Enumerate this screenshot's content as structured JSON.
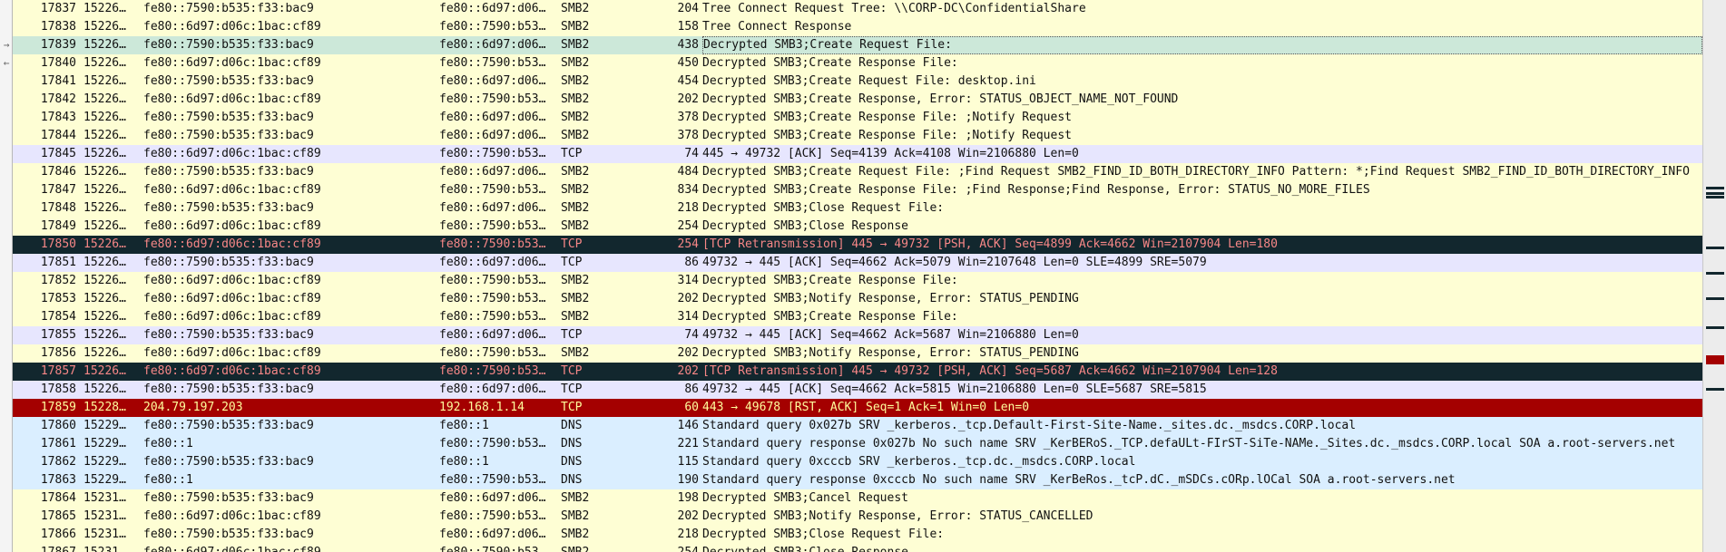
{
  "packet_list": {
    "rows": [
      {
        "no": "17837",
        "time": "15226…",
        "src": "fe80::7590:b535:f33:bac9",
        "dst": "fe80::6d97:d06…",
        "proto": "SMB2",
        "len": "204",
        "info": "Tree Connect Request Tree: \\\\CORP-DC\\ConfidentialShare",
        "style": "smb",
        "mark": ""
      },
      {
        "no": "17838",
        "time": "15226…",
        "src": "fe80::6d97:d06c:1bac:cf89",
        "dst": "fe80::7590:b53…",
        "proto": "SMB2",
        "len": "158",
        "info": "Tree Connect Response",
        "style": "smb",
        "mark": ""
      },
      {
        "no": "17839",
        "time": "15226…",
        "src": "fe80::7590:b535:f33:bac9",
        "dst": "fe80::6d97:d06…",
        "proto": "SMB2",
        "len": "438",
        "info": "Decrypted SMB3;Create Request File:",
        "style": "selected",
        "mark": "→"
      },
      {
        "no": "17840",
        "time": "15226…",
        "src": "fe80::6d97:d06c:1bac:cf89",
        "dst": "fe80::7590:b53…",
        "proto": "SMB2",
        "len": "450",
        "info": "Decrypted SMB3;Create Response File:",
        "style": "smb",
        "mark": "←"
      },
      {
        "no": "17841",
        "time": "15226…",
        "src": "fe80::7590:b535:f33:bac9",
        "dst": "fe80::6d97:d06…",
        "proto": "SMB2",
        "len": "454",
        "info": "Decrypted SMB3;Create Request File: desktop.ini",
        "style": "smb",
        "mark": ""
      },
      {
        "no": "17842",
        "time": "15226…",
        "src": "fe80::6d97:d06c:1bac:cf89",
        "dst": "fe80::7590:b53…",
        "proto": "SMB2",
        "len": "202",
        "info": "Decrypted SMB3;Create Response, Error: STATUS_OBJECT_NAME_NOT_FOUND",
        "style": "smb",
        "mark": ""
      },
      {
        "no": "17843",
        "time": "15226…",
        "src": "fe80::7590:b535:f33:bac9",
        "dst": "fe80::6d97:d06…",
        "proto": "SMB2",
        "len": "378",
        "info": "Decrypted SMB3;Create Response File: ;Notify Request",
        "style": "smb",
        "mark": ""
      },
      {
        "no": "17844",
        "time": "15226…",
        "src": "fe80::7590:b535:f33:bac9",
        "dst": "fe80::6d97:d06…",
        "proto": "SMB2",
        "len": "378",
        "info": "Decrypted SMB3;Create Response File: ;Notify Request",
        "style": "smb",
        "mark": ""
      },
      {
        "no": "17845",
        "time": "15226…",
        "src": "fe80::6d97:d06c:1bac:cf89",
        "dst": "fe80::7590:b53…",
        "proto": "TCP",
        "len": "74",
        "info": "445 → 49732 [ACK] Seq=4139 Ack=4108 Win=2106880 Len=0",
        "style": "tcp",
        "mark": ""
      },
      {
        "no": "17846",
        "time": "15226…",
        "src": "fe80::7590:b535:f33:bac9",
        "dst": "fe80::6d97:d06…",
        "proto": "SMB2",
        "len": "484",
        "info": "Decrypted SMB3;Create Request File: ;Find Request SMB2_FIND_ID_BOTH_DIRECTORY_INFO Pattern: *;Find Request SMB2_FIND_ID_BOTH_DIRECTORY_INFO",
        "style": "smb",
        "mark": ""
      },
      {
        "no": "17847",
        "time": "15226…",
        "src": "fe80::6d97:d06c:1bac:cf89",
        "dst": "fe80::7590:b53…",
        "proto": "SMB2",
        "len": "834",
        "info": "Decrypted SMB3;Create Response File: ;Find Response;Find Response, Error: STATUS_NO_MORE_FILES",
        "style": "smb",
        "mark": ""
      },
      {
        "no": "17848",
        "time": "15226…",
        "src": "fe80::7590:b535:f33:bac9",
        "dst": "fe80::6d97:d06…",
        "proto": "SMB2",
        "len": "218",
        "info": "Decrypted SMB3;Close Request File:",
        "style": "smb",
        "mark": ""
      },
      {
        "no": "17849",
        "time": "15226…",
        "src": "fe80::6d97:d06c:1bac:cf89",
        "dst": "fe80::7590:b53…",
        "proto": "SMB2",
        "len": "254",
        "info": "Decrypted SMB3;Close Response",
        "style": "smb",
        "mark": ""
      },
      {
        "no": "17850",
        "time": "15226…",
        "src": "fe80::6d97:d06c:1bac:cf89",
        "dst": "fe80::7590:b53…",
        "proto": "TCP",
        "len": "254",
        "info": "[TCP Retransmission] 445 → 49732 [PSH, ACK] Seq=4899 Ack=4662 Win=2107904 Len=180",
        "style": "bad",
        "mark": ""
      },
      {
        "no": "17851",
        "time": "15226…",
        "src": "fe80::7590:b535:f33:bac9",
        "dst": "fe80::6d97:d06…",
        "proto": "TCP",
        "len": "86",
        "info": "49732 → 445 [ACK] Seq=4662 Ack=5079 Win=2107648 Len=0 SLE=4899 SRE=5079",
        "style": "tcp",
        "mark": ""
      },
      {
        "no": "17852",
        "time": "15226…",
        "src": "fe80::6d97:d06c:1bac:cf89",
        "dst": "fe80::7590:b53…",
        "proto": "SMB2",
        "len": "314",
        "info": "Decrypted SMB3;Create Response File:",
        "style": "smb",
        "mark": ""
      },
      {
        "no": "17853",
        "time": "15226…",
        "src": "fe80::6d97:d06c:1bac:cf89",
        "dst": "fe80::7590:b53…",
        "proto": "SMB2",
        "len": "202",
        "info": "Decrypted SMB3;Notify Response, Error: STATUS_PENDING",
        "style": "smb",
        "mark": ""
      },
      {
        "no": "17854",
        "time": "15226…",
        "src": "fe80::6d97:d06c:1bac:cf89",
        "dst": "fe80::7590:b53…",
        "proto": "SMB2",
        "len": "314",
        "info": "Decrypted SMB3;Create Response File:",
        "style": "smb",
        "mark": ""
      },
      {
        "no": "17855",
        "time": "15226…",
        "src": "fe80::7590:b535:f33:bac9",
        "dst": "fe80::6d97:d06…",
        "proto": "TCP",
        "len": "74",
        "info": "49732 → 445 [ACK] Seq=4662 Ack=5687 Win=2106880 Len=0",
        "style": "tcp",
        "mark": ""
      },
      {
        "no": "17856",
        "time": "15226…",
        "src": "fe80::6d97:d06c:1bac:cf89",
        "dst": "fe80::7590:b53…",
        "proto": "SMB2",
        "len": "202",
        "info": "Decrypted SMB3;Notify Response, Error: STATUS_PENDING",
        "style": "smb",
        "mark": ""
      },
      {
        "no": "17857",
        "time": "15226…",
        "src": "fe80::6d97:d06c:1bac:cf89",
        "dst": "fe80::7590:b53…",
        "proto": "TCP",
        "len": "202",
        "info": "[TCP Retransmission] 445 → 49732 [PSH, ACK] Seq=5687 Ack=4662 Win=2107904 Len=128",
        "style": "bad",
        "mark": ""
      },
      {
        "no": "17858",
        "time": "15226…",
        "src": "fe80::7590:b535:f33:bac9",
        "dst": "fe80::6d97:d06…",
        "proto": "TCP",
        "len": "86",
        "info": "49732 → 445 [ACK] Seq=4662 Ack=5815 Win=2106880 Len=0 SLE=5687 SRE=5815",
        "style": "tcp",
        "mark": ""
      },
      {
        "no": "17859",
        "time": "15228…",
        "src": "204.79.197.203",
        "dst": "192.168.1.14",
        "proto": "TCP",
        "len": "60",
        "info": "443 → 49678 [RST, ACK] Seq=1 Ack=1 Win=0 Len=0",
        "style": "rst",
        "mark": ""
      },
      {
        "no": "17860",
        "time": "15229…",
        "src": "fe80::7590:b535:f33:bac9",
        "dst": "fe80::1",
        "proto": "DNS",
        "len": "146",
        "info": "Standard query 0x027b SRV _kerberos._tcp.Default-First-Site-Name._sites.dc._msdcs.CORP.local",
        "style": "dns",
        "mark": ""
      },
      {
        "no": "17861",
        "time": "15229…",
        "src": "fe80::1",
        "dst": "fe80::7590:b53…",
        "proto": "DNS",
        "len": "221",
        "info": "Standard query response 0x027b No such name SRV _KerBERoS._TCP.defaULt-FIrST-SiTe-NAMe._Sites.dc._msdcs.CORP.local SOA a.root-servers.net",
        "style": "dns",
        "mark": ""
      },
      {
        "no": "17862",
        "time": "15229…",
        "src": "fe80::7590:b535:f33:bac9",
        "dst": "fe80::1",
        "proto": "DNS",
        "len": "115",
        "info": "Standard query 0xcccb SRV _kerberos._tcp.dc._msdcs.CORP.local",
        "style": "dns",
        "mark": ""
      },
      {
        "no": "17863",
        "time": "15229…",
        "src": "fe80::1",
        "dst": "fe80::7590:b53…",
        "proto": "DNS",
        "len": "190",
        "info": "Standard query response 0xcccb No such name SRV _KerBeRos._tcP.dC._mSDCs.cORp.lOCal SOA a.root-servers.net",
        "style": "dns",
        "mark": ""
      },
      {
        "no": "17864",
        "time": "15231…",
        "src": "fe80::7590:b535:f33:bac9",
        "dst": "fe80::6d97:d06…",
        "proto": "SMB2",
        "len": "198",
        "info": "Decrypted SMB3;Cancel Request",
        "style": "smb",
        "mark": ""
      },
      {
        "no": "17865",
        "time": "15231…",
        "src": "fe80::6d97:d06c:1bac:cf89",
        "dst": "fe80::7590:b53…",
        "proto": "SMB2",
        "len": "202",
        "info": "Decrypted SMB3;Notify Response, Error: STATUS_CANCELLED",
        "style": "smb",
        "mark": ""
      },
      {
        "no": "17866",
        "time": "15231…",
        "src": "fe80::7590:b535:f33:bac9",
        "dst": "fe80::6d97:d06…",
        "proto": "SMB2",
        "len": "218",
        "info": "Decrypted SMB3;Close Request File:",
        "style": "smb",
        "mark": ""
      },
      {
        "no": "17867",
        "time": "15231…",
        "src": "fe80::6d97:d06c:1bac:cf89",
        "dst": "fe80::7590:b53…",
        "proto": "SMB2",
        "len": "254",
        "info": "Decrypted SMB3;Close Response",
        "style": "smb",
        "mark": ""
      }
    ]
  },
  "colors": {
    "smb": "#fefed4",
    "tcp": "#e7e6fe",
    "dns": "#daeeff",
    "bad_bg": "#12272e",
    "bad_fg": "#f78787",
    "rst_bg": "#a40000",
    "rst_fg": "#fffc9c",
    "selected": "#cce8d9"
  },
  "scrollbar": {
    "minimap_marks": [
      "dark",
      "dark",
      "dark",
      "dark",
      "dark",
      "dark",
      "dark",
      "red",
      "dark"
    ]
  }
}
